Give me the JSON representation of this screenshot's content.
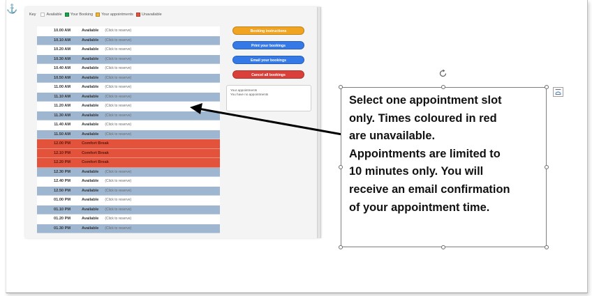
{
  "key": {
    "label": "Key",
    "items": [
      {
        "label": "Available",
        "color": "#ffffff"
      },
      {
        "label": "Your Booking",
        "color": "#1aa34a"
      },
      {
        "label": "Your appointments",
        "color": "#f2b632"
      },
      {
        "label": "Unavailable",
        "color": "#e3533c"
      }
    ]
  },
  "slots": [
    {
      "time": "10.00 AM",
      "status": "Available",
      "action": "(Click to reserve)",
      "kind": "white"
    },
    {
      "time": "10.10 AM",
      "status": "Available",
      "action": "(Click to reserve)",
      "kind": "blue"
    },
    {
      "time": "10.20 AM",
      "status": "Available",
      "action": "(Click to reserve)",
      "kind": "white"
    },
    {
      "time": "10.30 AM",
      "status": "Available",
      "action": "(Click to reserve)",
      "kind": "blue"
    },
    {
      "time": "10.40 AM",
      "status": "Available",
      "action": "(Click to reserve)",
      "kind": "white"
    },
    {
      "time": "10.50 AM",
      "status": "Available",
      "action": "(Click to reserve)",
      "kind": "blue"
    },
    {
      "time": "11.00 AM",
      "status": "Available",
      "action": "(Click to reserve)",
      "kind": "white"
    },
    {
      "time": "11.10 AM",
      "status": "Available",
      "action": "(Click to reserve)",
      "kind": "blue"
    },
    {
      "time": "11.20 AM",
      "status": "Available",
      "action": "(Click to reserve)",
      "kind": "white"
    },
    {
      "time": "11.30 AM",
      "status": "Available",
      "action": "(Click to reserve)",
      "kind": "blue"
    },
    {
      "time": "11.40 AM",
      "status": "Available",
      "action": "(Click to reserve)",
      "kind": "white"
    },
    {
      "time": "11.50 AM",
      "status": "Available",
      "action": "(Click to reserve)",
      "kind": "blue"
    },
    {
      "time": "12.00 PM",
      "status": "Comfort Break",
      "action": "",
      "kind": "red"
    },
    {
      "time": "12.10 PM",
      "status": "Comfort Break",
      "action": "",
      "kind": "red"
    },
    {
      "time": "12.20 PM",
      "status": "Comfort Break",
      "action": "",
      "kind": "red"
    },
    {
      "time": "12.30 PM",
      "status": "Available",
      "action": "(Click to reserve)",
      "kind": "blue"
    },
    {
      "time": "12.40 PM",
      "status": "Available",
      "action": "(Click to reserve)",
      "kind": "white"
    },
    {
      "time": "12.50 PM",
      "status": "Available",
      "action": "(Click to reserve)",
      "kind": "blue"
    },
    {
      "time": "01.00 PM",
      "status": "Available",
      "action": "(Click to reserve)",
      "kind": "white"
    },
    {
      "time": "01.10 PM",
      "status": "Available",
      "action": "(Click to reserve)",
      "kind": "blue"
    },
    {
      "time": "01.20 PM",
      "status": "Available",
      "action": "(Click to reserve)",
      "kind": "white"
    },
    {
      "time": "01.30 PM",
      "status": "Available",
      "action": "(Click to reserve)",
      "kind": "blue"
    }
  ],
  "buttons": [
    {
      "label": "Booking instructions",
      "color": "#f0a422"
    },
    {
      "label": "Print your bookings",
      "color": "#3579e6"
    },
    {
      "label": "Email your bookings",
      "color": "#3579e6"
    },
    {
      "label": "Cancel all bookings",
      "color": "#d9403a"
    }
  ],
  "appointments": {
    "title": "Your appointments",
    "empty": "You have no appointments"
  },
  "colors": {
    "row_blue": "#9fb6d0",
    "row_red": "#e3533c",
    "arrow": "#000000"
  },
  "textbox": {
    "lines": [
      "Select one appointment slot",
      "only. Times coloured in red",
      "are unavailable.",
      "Appointments are limited to",
      "10 minutes only. You will",
      "receive an email confirmation",
      "of your appointment time."
    ]
  },
  "icons": {
    "anchor": "anchor-icon",
    "rotate": "rotate-handle-icon",
    "layout": "layout-options-icon"
  }
}
